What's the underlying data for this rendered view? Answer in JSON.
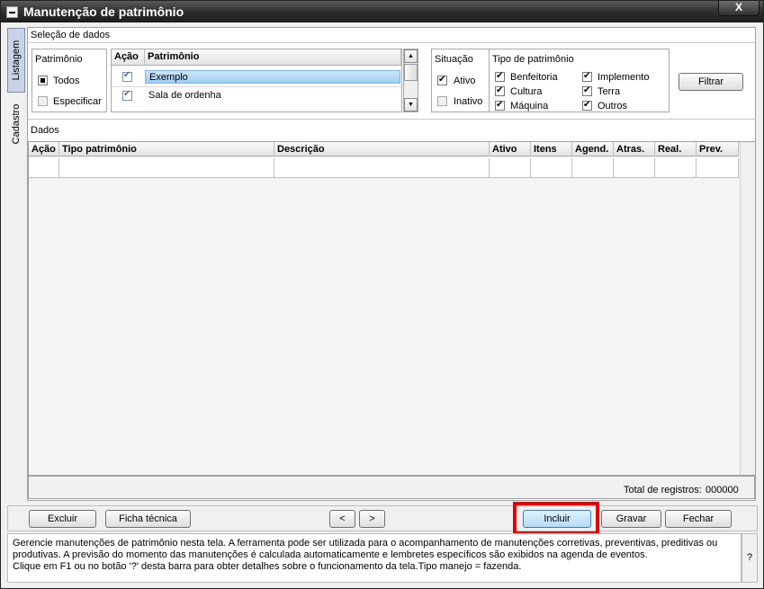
{
  "window": {
    "title": "Manutenção de patrimônio",
    "close_label": "X"
  },
  "side_tabs": {
    "listagem": "Listagem",
    "cadastro": "Cadastro"
  },
  "selection": {
    "section_label": "Seleção de dados",
    "patrimonio_group": {
      "label": "Patrimônio",
      "todos": "Todos",
      "especificar": "Especificar"
    },
    "list": {
      "col_acao": "Ação",
      "col_patrimonio": "Patrimônio",
      "rows": [
        {
          "name": "Exemplo",
          "selected": true
        },
        {
          "name": "Sala de ordenha",
          "selected": false
        }
      ]
    },
    "situacao": {
      "label": "Situação",
      "ativo": "Ativo",
      "inativo": "Inativo"
    },
    "tipo": {
      "label": "Tipo de patrimônio",
      "benfeitoria": "Benfeitoria",
      "implemento": "Implemento",
      "cultura": "Cultura",
      "terra": "Terra",
      "maquina": "Máquina",
      "outros": "Outros"
    },
    "filtrar_label": "Filtrar"
  },
  "dados": {
    "section_label": "Dados",
    "columns": [
      "Ação",
      "Tipo patrimônio",
      "Descrição",
      "Ativo",
      "Itens",
      "Agend.",
      "Atras.",
      "Real.",
      "Prev."
    ],
    "total_label": "Total de registros:",
    "total_value": "000000"
  },
  "footer": {
    "excluir": "Excluir",
    "ficha": "Ficha técnica",
    "prev": "<",
    "next": ">",
    "incluir": "Incluir",
    "gravar": "Gravar",
    "fechar": "Fechar"
  },
  "help": {
    "line1": "Gerencie manutenções de patrimônio nesta tela. A ferramenta pode ser utilizada para o acompanhamento de manutenções corretivas, preventivas, preditivas ou",
    "line2": "produtivas. A previsão do momento das manutenções é calculada automaticamente e lembretes específicos são exibidos na agenda de eventos.",
    "line3": "Clique em F1 ou no botão '?' desta barra para obter detalhes sobre o funcionamento da tela.Tipo manejo = fazenda.",
    "question": "?"
  },
  "colors": {
    "highlight": "#e00000",
    "selected_row": "#a9d3f5",
    "tab_active": "#c9d3e7"
  }
}
